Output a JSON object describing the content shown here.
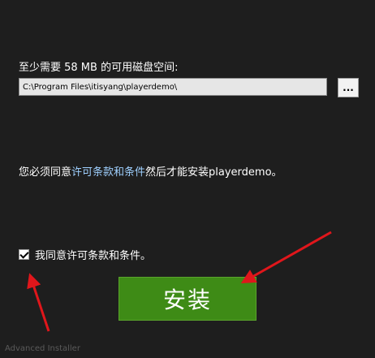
{
  "disk_space": {
    "label": "至少需要 58 MB 的可用磁盘空间:"
  },
  "install_path": {
    "value": "C:\\Program Files\\itisyang\\playerdemo\\",
    "browse_label": "..."
  },
  "license": {
    "prefix": "您必须同意",
    "link_text": "许可条款和条件",
    "suffix": "然后才能安装playerdemo。"
  },
  "agree_checkbox": {
    "checked": true,
    "label": "我同意许可条款和条件。"
  },
  "install_button": {
    "label": "安装"
  },
  "footer": {
    "brand": "Advanced Installer"
  },
  "colors": {
    "background": "#1e1e1e",
    "install_button": "#3e8b16",
    "link": "#9fd0ff",
    "annotation_arrow": "#e0161b"
  }
}
